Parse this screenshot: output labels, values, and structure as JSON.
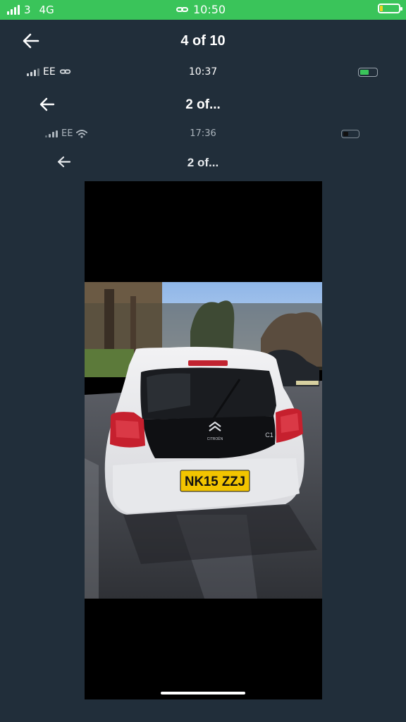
{
  "device_status": {
    "carrier": "3",
    "network": "4G",
    "time": "10:50"
  },
  "header": {
    "title": "4 of 10"
  },
  "screenshot_level1": {
    "carrier": "EE",
    "time": "10:37",
    "title": "2 of..."
  },
  "screenshot_level2": {
    "carrier": "EE",
    "time": "17:36",
    "title": "2 of..."
  },
  "photo": {
    "plate": "NK15 ZZJ",
    "badge": "C1",
    "brand": "CITROËN"
  },
  "colors": {
    "status_bar": "#3ac45a",
    "background": "#212e3a",
    "battery_low": "#f2d21f",
    "battery_charging": "#3ac45a"
  },
  "icons": {
    "back": "arrow-left-icon",
    "signal": "signal-bars-icon",
    "link": "link-icon",
    "wifi": "wifi-icon",
    "battery": "battery-icon"
  }
}
